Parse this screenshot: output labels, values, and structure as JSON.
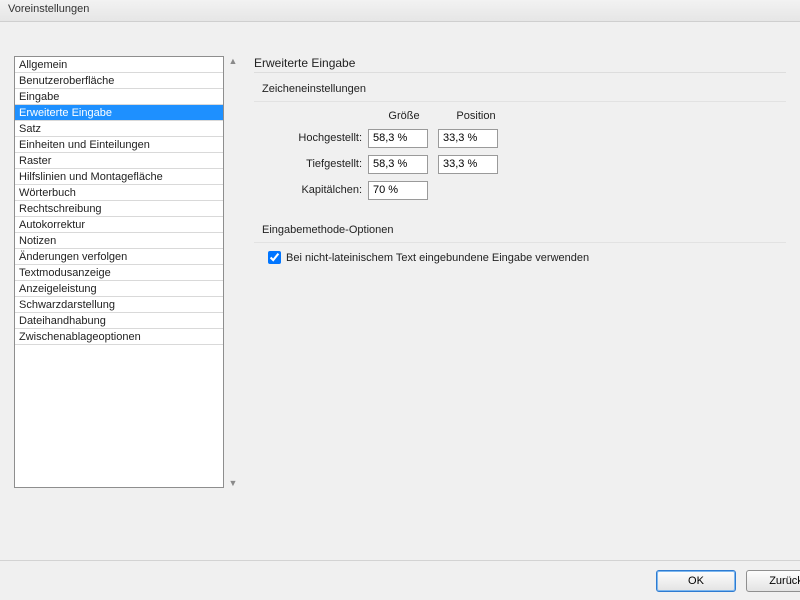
{
  "window": {
    "title": "Voreinstellungen"
  },
  "sidebar": {
    "items": [
      "Allgemein",
      "Benutzeroberfläche",
      "Eingabe",
      "Erweiterte Eingabe",
      "Satz",
      "Einheiten und Einteilungen",
      "Raster",
      "Hilfslinien und Montagefläche",
      "Wörterbuch",
      "Rechtschreibung",
      "Autokorrektur",
      "Notizen",
      "Änderungen verfolgen",
      "Textmodusanzeige",
      "Anzeigeleistung",
      "Schwarzdarstellung",
      "Dateihandhabung",
      "Zwischenablageoptionen"
    ],
    "selected_index": 3
  },
  "panel": {
    "title": "Erweiterte Eingabe",
    "char_settings": {
      "title": "Zeicheneinstellungen",
      "col_size": "Größe",
      "col_position": "Position",
      "rows": {
        "superscript": {
          "label": "Hochgestellt:",
          "size": "58,3 %",
          "position": "33,3 %"
        },
        "subscript": {
          "label": "Tiefgestellt:",
          "size": "58,3 %",
          "position": "33,3 %"
        },
        "smallcaps": {
          "label": "Kapitälchen:",
          "size": "70 %"
        }
      }
    },
    "ime": {
      "title": "Eingabemethode-Optionen",
      "checkbox_label": "Bei nicht-lateinischem Text eingebundene Eingabe verwenden",
      "checked": true
    }
  },
  "buttons": {
    "ok": "OK",
    "back": "Zurück"
  }
}
